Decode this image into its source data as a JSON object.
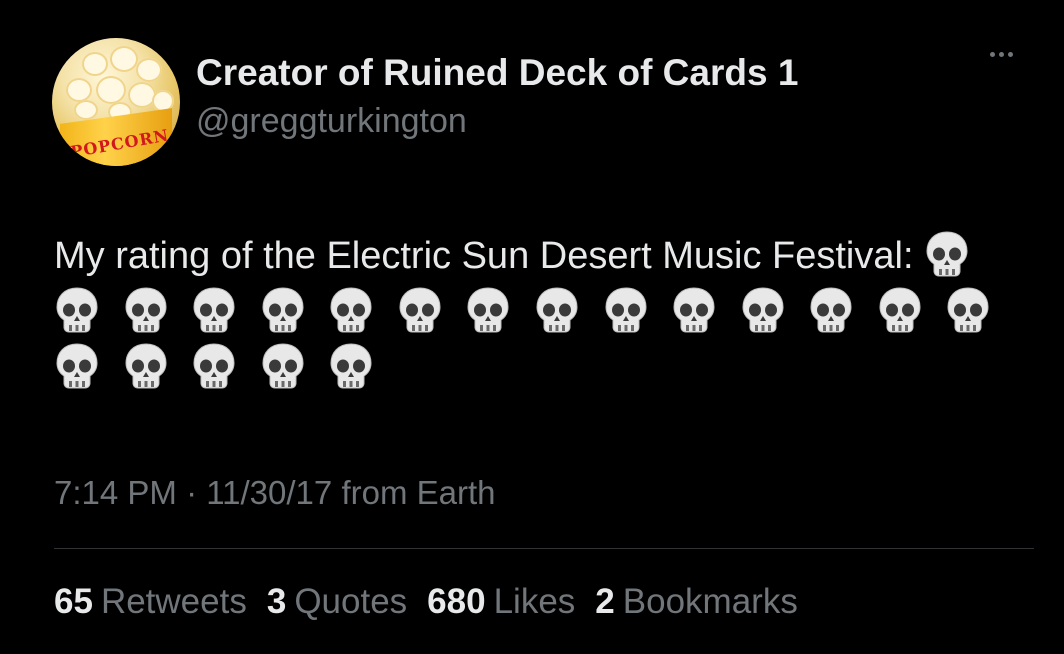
{
  "author": {
    "display_name": "Creator of Ruined Deck of Cards 1",
    "handle": "@greggturkington",
    "avatar_text": "POPCORN"
  },
  "tweet": {
    "text": "My rating of the Electric Sun Desert Music Festival:",
    "rating_icon": "skull-emoji",
    "rating_count": 20
  },
  "meta": {
    "time": "7:14 PM",
    "separator": "·",
    "date": "11/30/17",
    "source": "from Earth"
  },
  "stats": [
    {
      "num": "65",
      "label": "Retweets"
    },
    {
      "num": "3",
      "label": "Quotes"
    },
    {
      "num": "680",
      "label": "Likes"
    },
    {
      "num": "2",
      "label": "Bookmarks"
    }
  ],
  "colors": {
    "background": "#000000",
    "primary_text": "#e7e9ea",
    "secondary_text": "#71767b",
    "divider": "#2f3336"
  }
}
